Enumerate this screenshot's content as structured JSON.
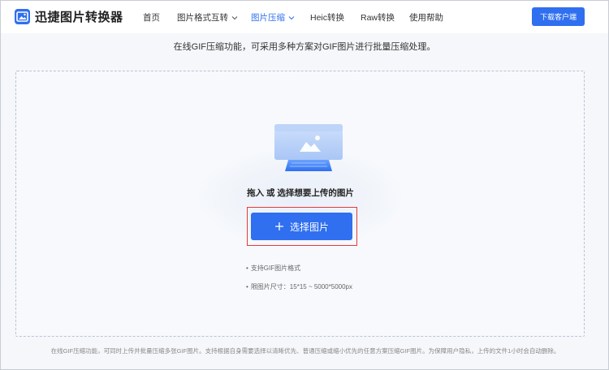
{
  "header": {
    "logo_text": "迅捷图片转换器",
    "nav": [
      {
        "label": "首页",
        "active": false,
        "dropdown": false
      },
      {
        "label": "图片格式互转",
        "active": false,
        "dropdown": true
      },
      {
        "label": "图片压缩",
        "active": true,
        "dropdown": true
      },
      {
        "label": "Heic转换",
        "active": false,
        "dropdown": false
      },
      {
        "label": "Raw转换",
        "active": false,
        "dropdown": false
      },
      {
        "label": "使用帮助",
        "active": false,
        "dropdown": false
      }
    ],
    "download_label": "下载客户端"
  },
  "subtitle": "在线GIF压缩功能，可采用多种方案对GIF图片进行批量压缩处理。",
  "upload": {
    "drop_text": "拖入 或 选择想要上传的图片",
    "select_label": "选择图片",
    "tips": [
      "支持GIF图片格式",
      "限图片尺寸：15*15 ~ 5000*5000px"
    ]
  },
  "footer": "在线GIF压缩功能，可同时上传并批量压缩多张GIF图片。支持根据自身需要选择以清晰优先、普通压缩或缩小优先的任意方案压缩GIF图片。为保障用户隐私，上传的文件1小时会自动删除。",
  "colors": {
    "accent": "#2f6ff0",
    "highlight_border": "#e23b3b"
  },
  "icons": [
    "logo-icon",
    "chevron-down-icon",
    "plus-icon",
    "image-upload-illustration"
  ]
}
